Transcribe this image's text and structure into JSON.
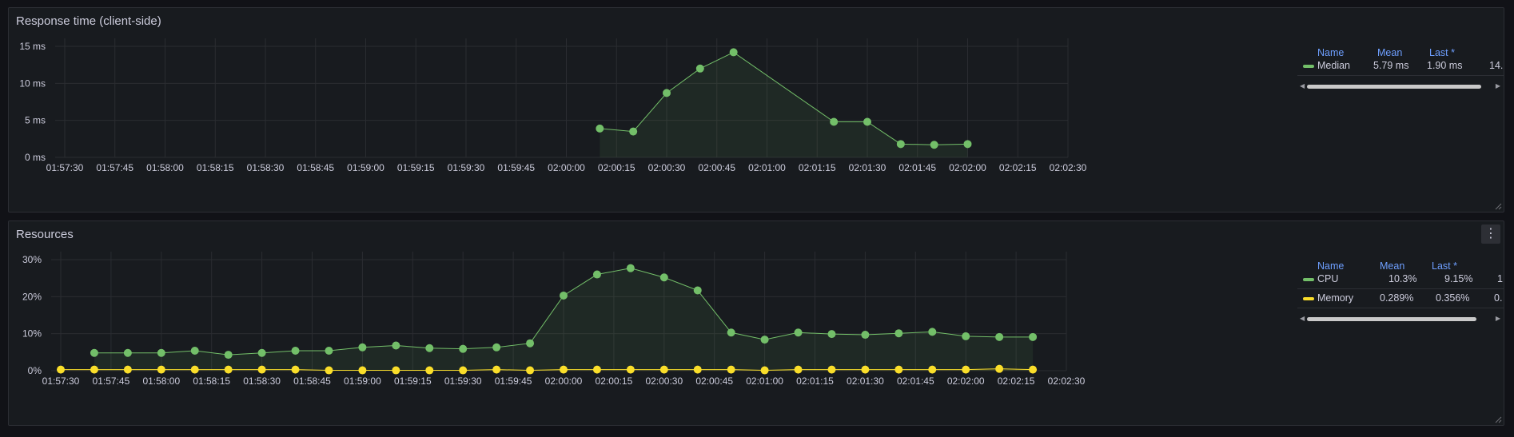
{
  "panels": [
    {
      "title": "Response time (client-side)",
      "legend": {
        "headers": {
          "name": "Name",
          "mean": "Mean",
          "last": "Last *"
        },
        "rows": [
          {
            "color": "#73bf69",
            "name": "Median",
            "mean": "5.79 ms",
            "last": "1.90 ms",
            "extra": "14."
          }
        ]
      },
      "chart_data": {
        "type": "line",
        "x_ticks": [
          "01:57:30",
          "01:57:45",
          "01:58:00",
          "01:58:15",
          "01:58:30",
          "01:58:45",
          "01:59:00",
          "01:59:15",
          "01:59:30",
          "01:59:45",
          "02:00:00",
          "02:00:15",
          "02:00:30",
          "02:00:45",
          "02:01:00",
          "02:01:15",
          "02:01:30",
          "02:01:45",
          "02:02:00",
          "02:02:15",
          "02:02:30"
        ],
        "y_ticks": [
          "0 ms",
          "5 ms",
          "10 ms",
          "15 ms"
        ],
        "ylim": [
          0,
          15
        ],
        "grid": true,
        "series": [
          {
            "name": "Median",
            "color": "#73bf69",
            "x": [
              "02:00:10",
              "02:00:20",
              "02:00:30",
              "02:00:40",
              "02:00:50",
              "02:01:20",
              "02:01:30",
              "02:01:40",
              "02:01:50",
              "02:02:00"
            ],
            "values": [
              3.9,
              3.5,
              8.7,
              12.0,
              14.2,
              4.8,
              4.8,
              1.8,
              1.7,
              1.8
            ]
          }
        ]
      }
    },
    {
      "title": "Resources",
      "menu_icon": "kebab-menu-icon",
      "legend": {
        "headers": {
          "name": "Name",
          "mean": "Mean",
          "last": "Last *"
        },
        "rows": [
          {
            "color": "#73bf69",
            "name": "CPU",
            "mean": "10.3%",
            "last": "9.15%",
            "extra": "1"
          },
          {
            "color": "#fade2a",
            "name": "Memory",
            "mean": "0.289%",
            "last": "0.356%",
            "extra": "0."
          }
        ]
      },
      "chart_data": {
        "type": "line",
        "x_ticks": [
          "01:57:30",
          "01:57:45",
          "01:58:00",
          "01:58:15",
          "01:58:30",
          "01:58:45",
          "01:59:00",
          "01:59:15",
          "01:59:30",
          "01:59:45",
          "02:00:00",
          "02:00:15",
          "02:00:30",
          "02:00:45",
          "02:01:00",
          "02:01:15",
          "02:01:30",
          "02:01:45",
          "02:02:00",
          "02:02:15",
          "02:02:30"
        ],
        "y_ticks": [
          "0%",
          "10%",
          "20%",
          "30%"
        ],
        "ylim": [
          0,
          30
        ],
        "grid": true,
        "series": [
          {
            "name": "CPU",
            "color": "#73bf69",
            "x": [
              "01:57:40",
              "01:57:50",
              "01:58:00",
              "01:58:10",
              "01:58:20",
              "01:58:30",
              "01:58:40",
              "01:58:50",
              "01:59:00",
              "01:59:10",
              "01:59:20",
              "01:59:30",
              "01:59:40",
              "01:59:50",
              "02:00:00",
              "02:00:10",
              "02:00:20",
              "02:00:30",
              "02:00:40",
              "02:00:50",
              "02:01:00",
              "02:01:10",
              "02:01:20",
              "02:01:30",
              "02:01:40",
              "02:01:50",
              "02:02:00",
              "02:02:10",
              "02:02:20"
            ],
            "values": [
              4.8,
              4.8,
              4.8,
              5.4,
              4.3,
              4.8,
              5.4,
              5.4,
              6.3,
              6.8,
              6.1,
              5.9,
              6.3,
              7.4,
              20.3,
              26.0,
              27.7,
              25.2,
              21.7,
              10.3,
              8.4,
              10.3,
              9.9,
              9.7,
              10.1,
              10.5,
              9.3,
              9.1,
              9.1
            ]
          },
          {
            "name": "Memory",
            "color": "#fade2a",
            "x": [
              "01:57:30",
              "01:57:40",
              "01:57:50",
              "01:58:00",
              "01:58:10",
              "01:58:20",
              "01:58:30",
              "01:58:40",
              "01:58:50",
              "01:59:00",
              "01:59:10",
              "01:59:20",
              "01:59:30",
              "01:59:40",
              "01:59:50",
              "02:00:00",
              "02:00:10",
              "02:00:20",
              "02:00:30",
              "02:00:40",
              "02:00:50",
              "02:01:00",
              "02:01:10",
              "02:01:20",
              "02:01:30",
              "02:01:40",
              "02:01:50",
              "02:02:00",
              "02:02:10",
              "02:02:20"
            ],
            "values": [
              0.3,
              0.3,
              0.3,
              0.3,
              0.3,
              0.3,
              0.3,
              0.3,
              0.1,
              0.1,
              0.1,
              0.1,
              0.1,
              0.3,
              0.1,
              0.3,
              0.3,
              0.3,
              0.3,
              0.3,
              0.3,
              0.1,
              0.3,
              0.3,
              0.3,
              0.3,
              0.3,
              0.3,
              0.5,
              0.3
            ]
          }
        ]
      }
    }
  ]
}
